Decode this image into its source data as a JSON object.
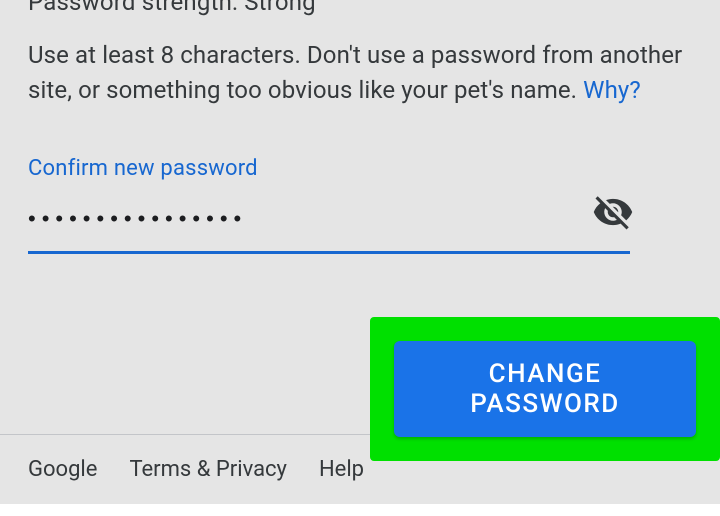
{
  "strength": {
    "label": "Password strength:",
    "value": "Strong"
  },
  "hint": {
    "text": "Use at least 8 characters. Don't use a password from another site, or something too obvious like your pet's name. ",
    "why_label": "Why?"
  },
  "confirm": {
    "label": "Confirm new password",
    "value": "••••••••••••••••"
  },
  "actions": {
    "change_password_label": "CHANGE PASSWORD"
  },
  "footer": {
    "google": "Google",
    "terms": "Terms & Privacy",
    "help": "Help"
  }
}
